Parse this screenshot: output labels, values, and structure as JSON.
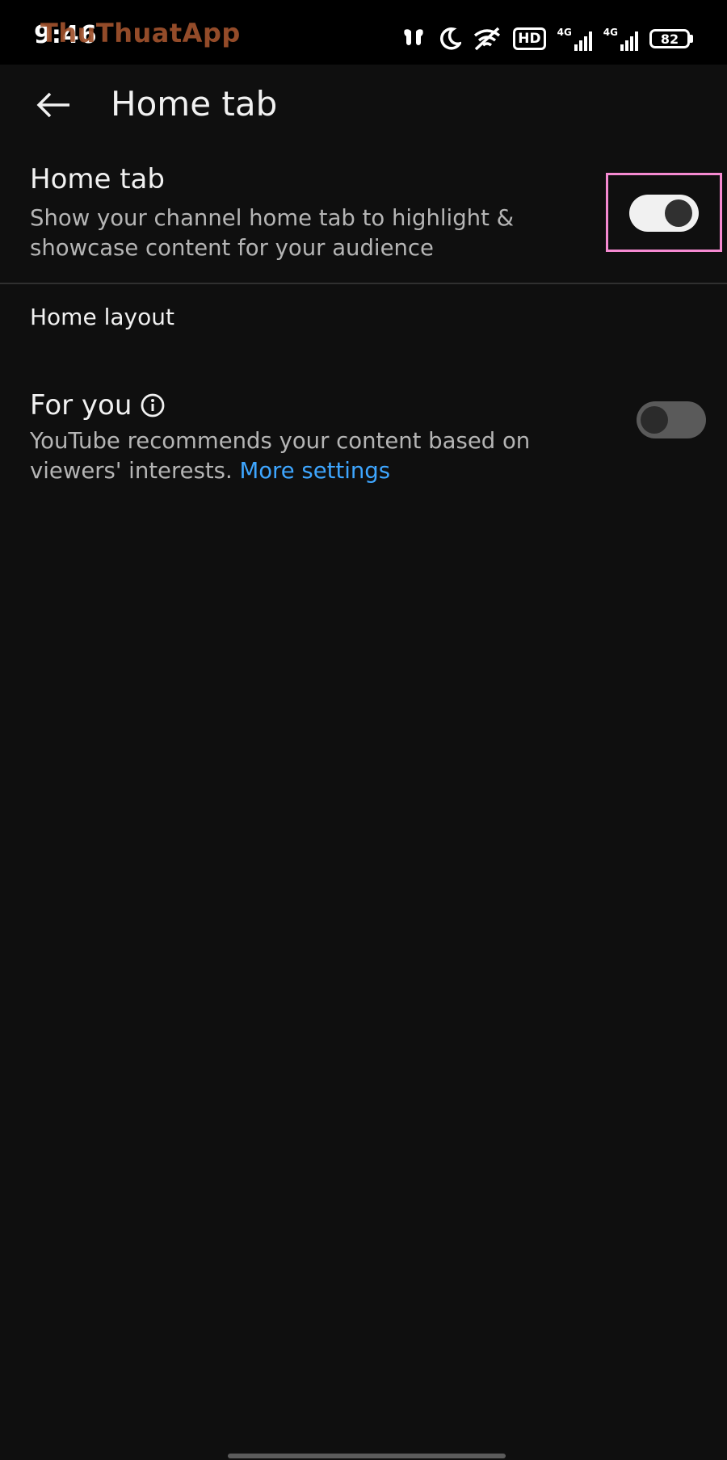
{
  "status_bar": {
    "time": "9:46",
    "watermark": "ThuThuatApp",
    "hd_label": "HD",
    "network_1": "4G",
    "network_2": "4G",
    "battery_level": "82",
    "icons": [
      "earbuds-icon",
      "moon-icon",
      "wifi-off-icon",
      "hd-icon",
      "signal-icon",
      "signal-icon",
      "battery-icon"
    ]
  },
  "header": {
    "back_icon": "arrow-left-icon",
    "title": "Home tab"
  },
  "settings": {
    "home_tab": {
      "title": "Home tab",
      "description": "Show your channel home tab to highlight & showcase content for your audience",
      "enabled": true,
      "highlighted": true
    },
    "section_header": "Home layout",
    "for_you": {
      "title": "For you",
      "info_icon": "info-icon",
      "description": "YouTube recommends your content based on viewers' interests.",
      "link": "More settings",
      "enabled": false
    }
  },
  "colors": {
    "background": "#0f0f0f",
    "status_bar": "#000000",
    "primary_text": "#f1f1f1",
    "secondary_text": "#b5b5b5",
    "link": "#3ea6ff",
    "highlight": "#f58ad1",
    "watermark": "#a0522d"
  }
}
